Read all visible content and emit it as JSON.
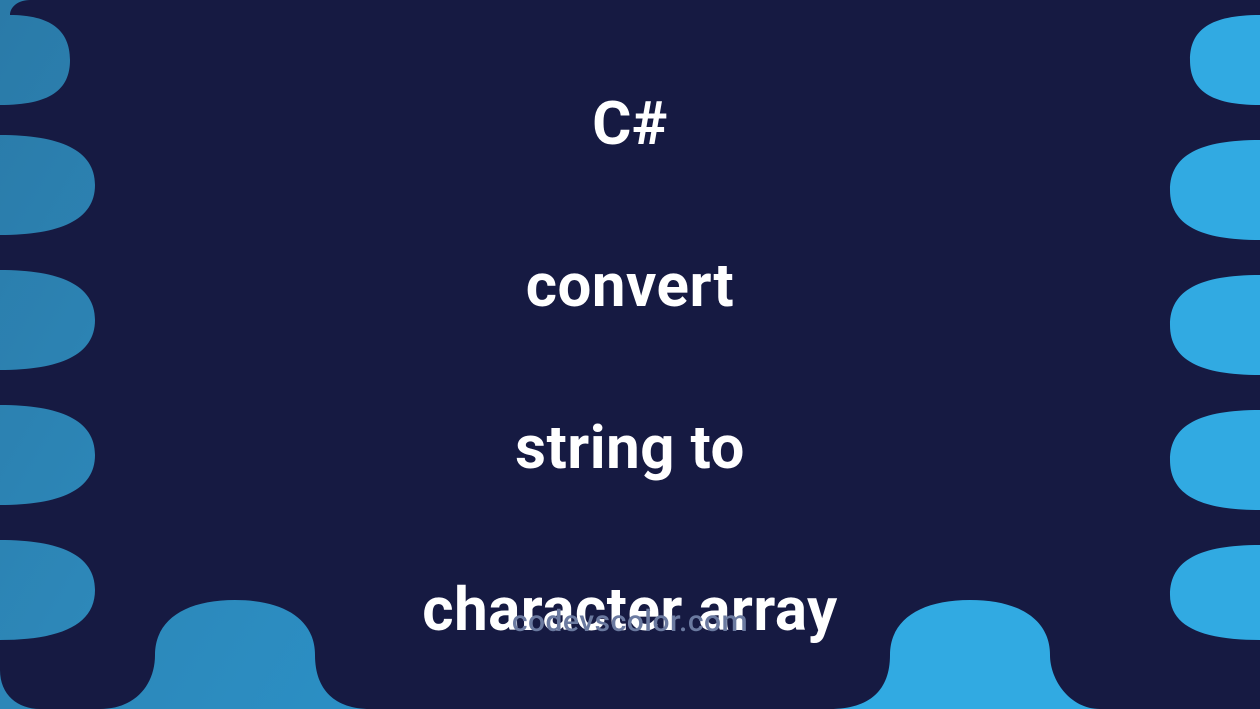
{
  "banner": {
    "title_line1": "C#",
    "title_line2": "convert",
    "title_line3": "string to",
    "title_line4": "character array",
    "watermark": "codevscolor.com"
  },
  "colors": {
    "dark_blob": "#161a42",
    "left_gradient_start": "#2a7aa8",
    "left_gradient_end": "#2995ce",
    "right_bg": "#31aae2",
    "title_text": "#ffffff",
    "watermark_text": "#6b7aa0"
  }
}
